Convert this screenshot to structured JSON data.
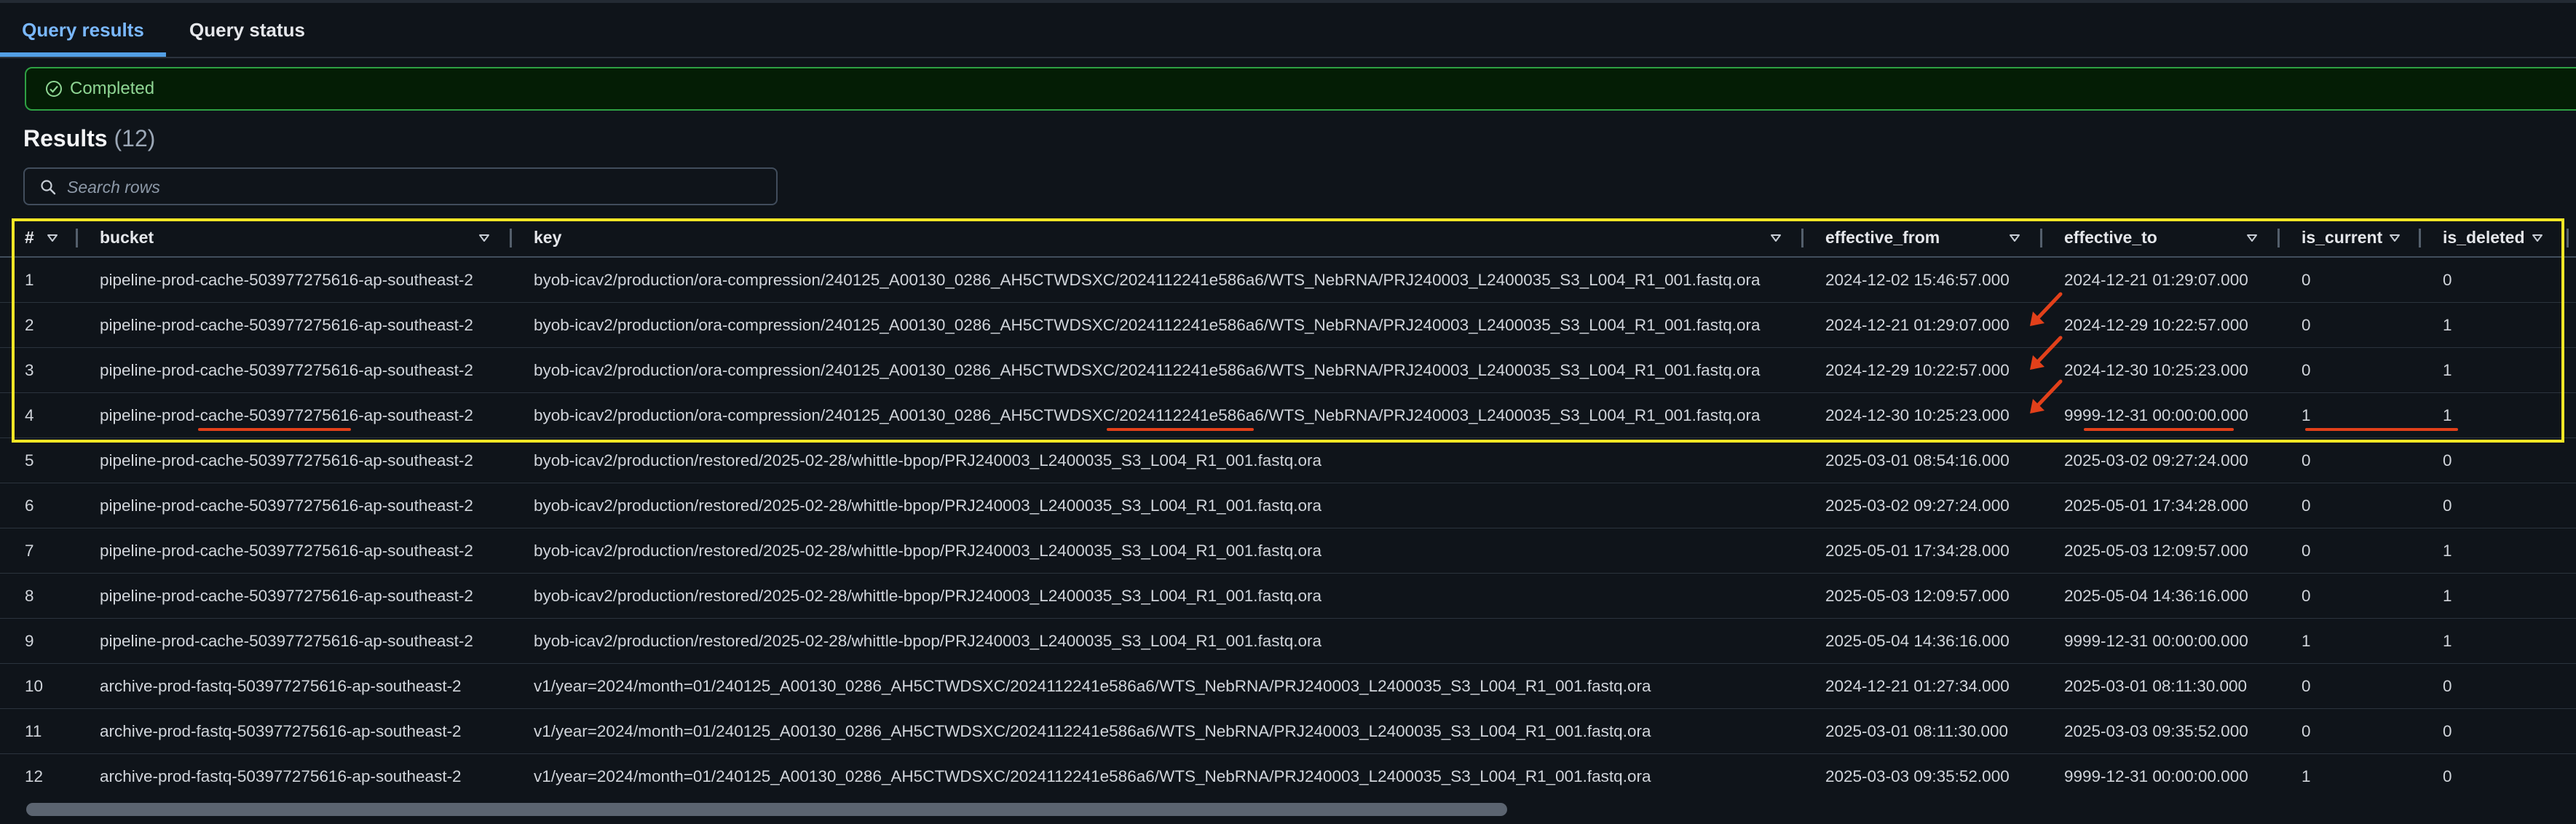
{
  "tabs": [
    {
      "label": "Query results",
      "active": true
    },
    {
      "label": "Query status",
      "active": false
    }
  ],
  "status": {
    "text": "Completed",
    "color": "#2ea043"
  },
  "results": {
    "title": "Results",
    "count": "(12)"
  },
  "search": {
    "placeholder": "Search rows",
    "value": ""
  },
  "table": {
    "columns": [
      "#",
      "bucket",
      "key",
      "effective_from",
      "effective_to",
      "is_current",
      "is_deleted"
    ],
    "rows": [
      [
        "1",
        "pipeline-prod-cache-503977275616-ap-southeast-2",
        "byob-icav2/production/ora-compression/240125_A00130_0286_AH5CTWDSXC/2024112241e586a6/WTS_NebRNA/PRJ240003_L2400035_S3_L004_R1_001.fastq.ora",
        "2024-12-02 15:46:57.000",
        "2024-12-21 01:29:07.000",
        "0",
        "0"
      ],
      [
        "2",
        "pipeline-prod-cache-503977275616-ap-southeast-2",
        "byob-icav2/production/ora-compression/240125_A00130_0286_AH5CTWDSXC/2024112241e586a6/WTS_NebRNA/PRJ240003_L2400035_S3_L004_R1_001.fastq.ora",
        "2024-12-21 01:29:07.000",
        "2024-12-29 10:22:57.000",
        "0",
        "1"
      ],
      [
        "3",
        "pipeline-prod-cache-503977275616-ap-southeast-2",
        "byob-icav2/production/ora-compression/240125_A00130_0286_AH5CTWDSXC/2024112241e586a6/WTS_NebRNA/PRJ240003_L2400035_S3_L004_R1_001.fastq.ora",
        "2024-12-29 10:22:57.000",
        "2024-12-30 10:25:23.000",
        "0",
        "1"
      ],
      [
        "4",
        "pipeline-prod-cache-503977275616-ap-southeast-2",
        "byob-icav2/production/ora-compression/240125_A00130_0286_AH5CTWDSXC/2024112241e586a6/WTS_NebRNA/PRJ240003_L2400035_S3_L004_R1_001.fastq.ora",
        "2024-12-30 10:25:23.000",
        "9999-12-31 00:00:00.000",
        "1",
        "1"
      ],
      [
        "5",
        "pipeline-prod-cache-503977275616-ap-southeast-2",
        "byob-icav2/production/restored/2025-02-28/whittle-bpop/PRJ240003_L2400035_S3_L004_R1_001.fastq.ora",
        "2025-03-01 08:54:16.000",
        "2025-03-02 09:27:24.000",
        "0",
        "0"
      ],
      [
        "6",
        "pipeline-prod-cache-503977275616-ap-southeast-2",
        "byob-icav2/production/restored/2025-02-28/whittle-bpop/PRJ240003_L2400035_S3_L004_R1_001.fastq.ora",
        "2025-03-02 09:27:24.000",
        "2025-05-01 17:34:28.000",
        "0",
        "0"
      ],
      [
        "7",
        "pipeline-prod-cache-503977275616-ap-southeast-2",
        "byob-icav2/production/restored/2025-02-28/whittle-bpop/PRJ240003_L2400035_S3_L004_R1_001.fastq.ora",
        "2025-05-01 17:34:28.000",
        "2025-05-03 12:09:57.000",
        "0",
        "1"
      ],
      [
        "8",
        "pipeline-prod-cache-503977275616-ap-southeast-2",
        "byob-icav2/production/restored/2025-02-28/whittle-bpop/PRJ240003_L2400035_S3_L004_R1_001.fastq.ora",
        "2025-05-03 12:09:57.000",
        "2025-05-04 14:36:16.000",
        "0",
        "1"
      ],
      [
        "9",
        "pipeline-prod-cache-503977275616-ap-southeast-2",
        "byob-icav2/production/restored/2025-02-28/whittle-bpop/PRJ240003_L2400035_S3_L004_R1_001.fastq.ora",
        "2025-05-04 14:36:16.000",
        "9999-12-31 00:00:00.000",
        "1",
        "1"
      ],
      [
        "10",
        "archive-prod-fastq-503977275616-ap-southeast-2",
        "v1/year=2024/month=01/240125_A00130_0286_AH5CTWDSXC/2024112241e586a6/WTS_NebRNA/PRJ240003_L2400035_S3_L004_R1_001.fastq.ora",
        "2024-12-21 01:27:34.000",
        "2025-03-01 08:11:30.000",
        "0",
        "0"
      ],
      [
        "11",
        "archive-prod-fastq-503977275616-ap-southeast-2",
        "v1/year=2024/month=01/240125_A00130_0286_AH5CTWDSXC/2024112241e586a6/WTS_NebRNA/PRJ240003_L2400035_S3_L004_R1_001.fastq.ora",
        "2025-03-01 08:11:30.000",
        "2025-03-03 09:35:52.000",
        "0",
        "0"
      ],
      [
        "12",
        "archive-prod-fastq-503977275616-ap-southeast-2",
        "v1/year=2024/month=01/240125_A00130_0286_AH5CTWDSXC/2024112241e586a6/WTS_NebRNA/PRJ240003_L2400035_S3_L004_R1_001.fastq.ora",
        "2025-03-03 09:35:52.000",
        "9999-12-31 00:00:00.000",
        "1",
        "0"
      ]
    ]
  },
  "annotations": {
    "highlight_color": "#f2e625",
    "mark_color": "#e2401a"
  },
  "icons": {
    "status": "check-circle-icon",
    "search": "search-icon",
    "sort": "caret-down-icon",
    "annotation": "arrow-icon"
  }
}
